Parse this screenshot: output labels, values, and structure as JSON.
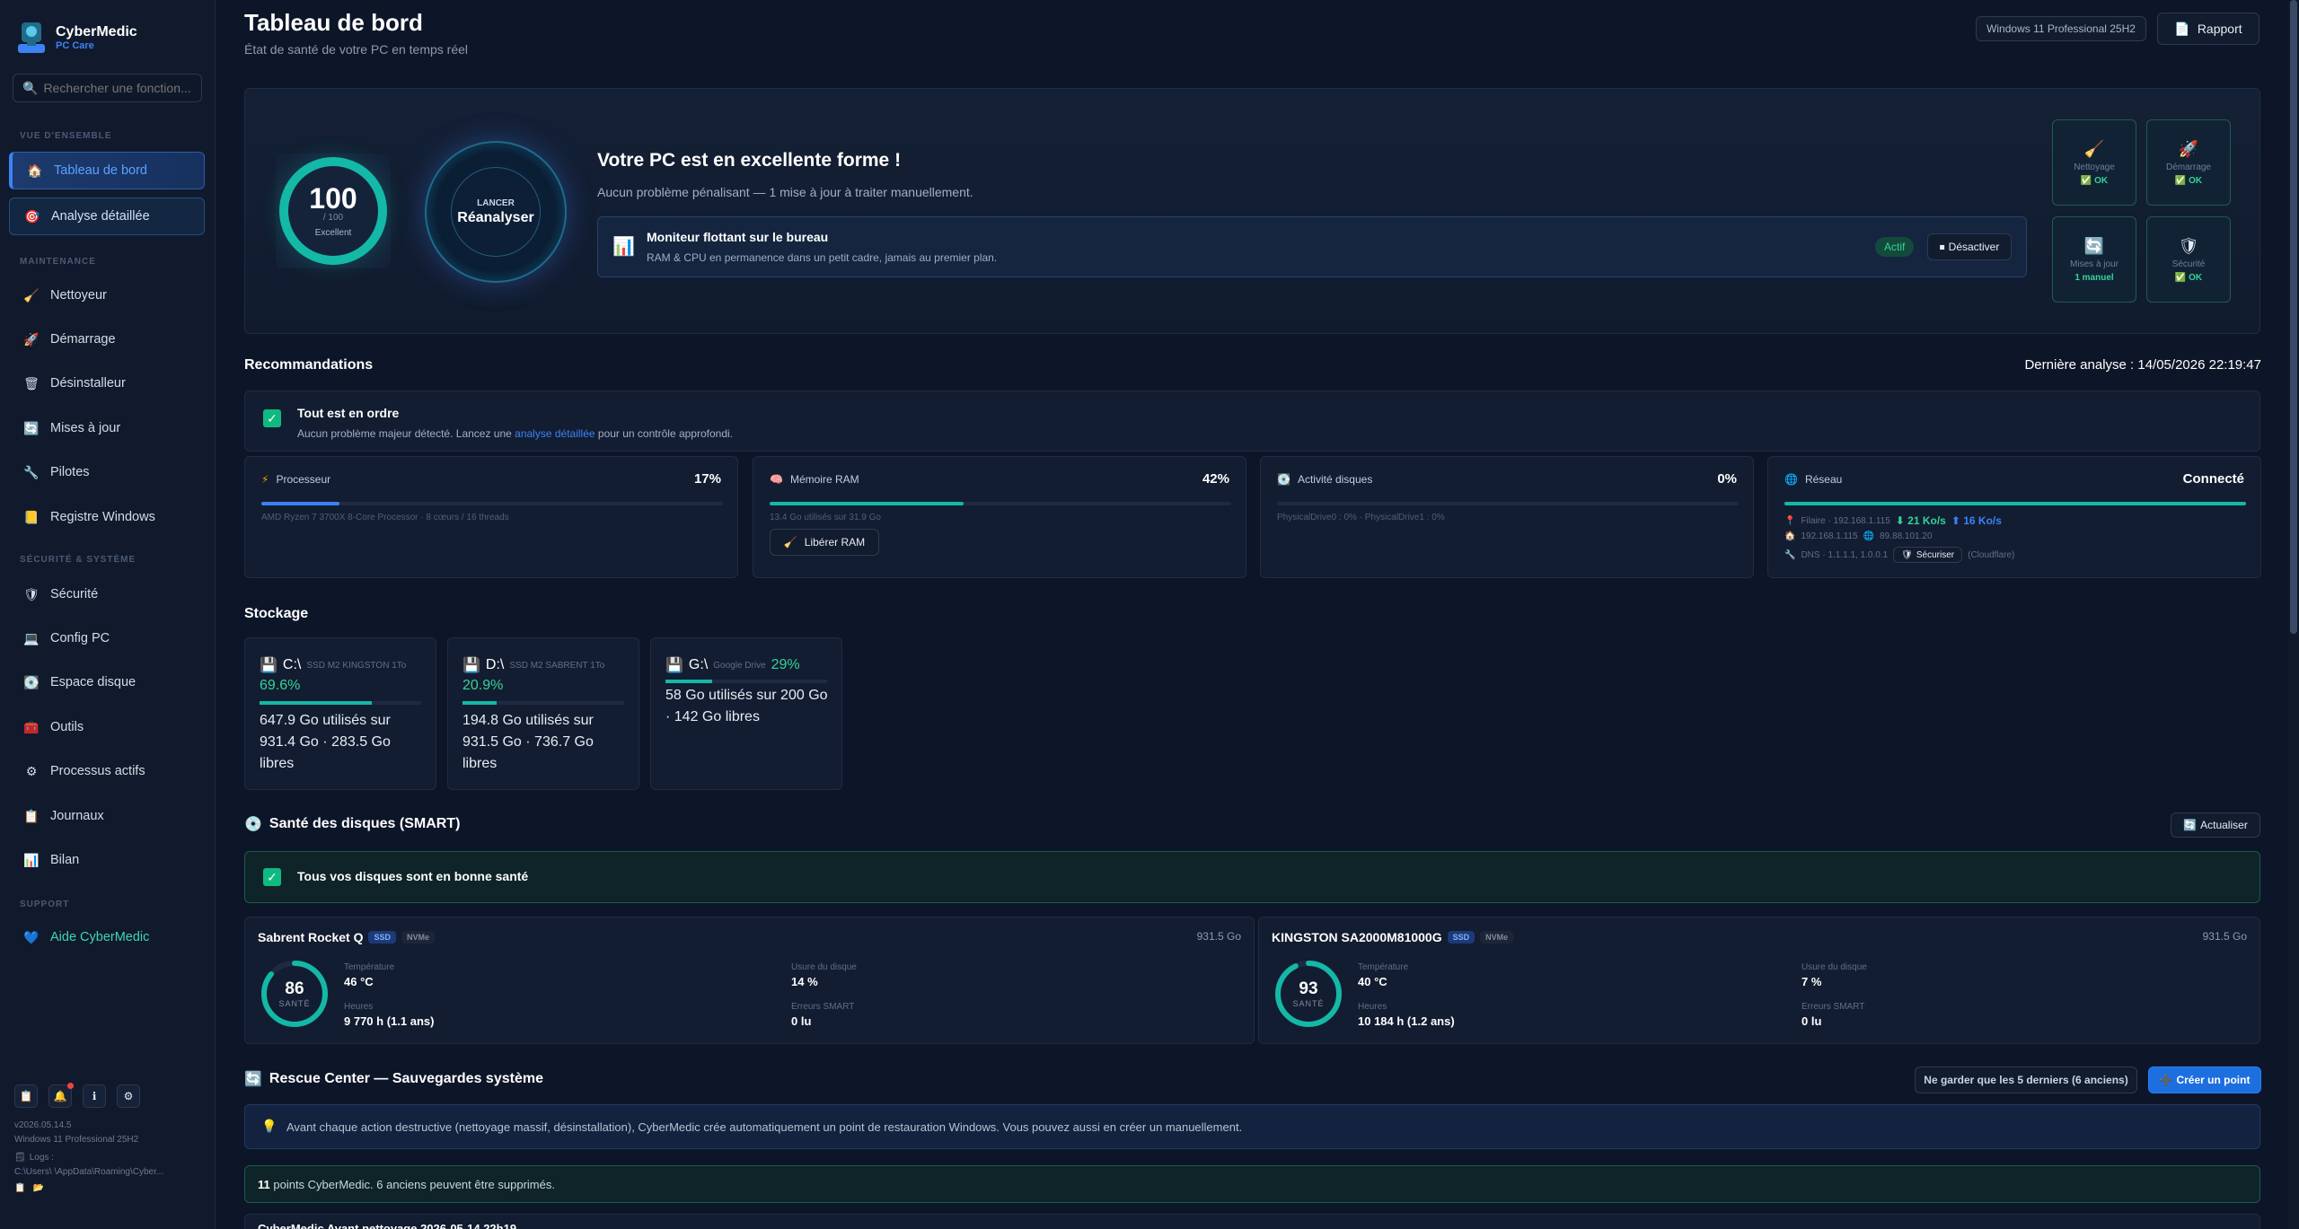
{
  "brand": {
    "name": "CyberMedic",
    "sub": "PC Care"
  },
  "search": {
    "placeholder": "Rechercher une fonction..."
  },
  "sidebar": {
    "sections": [
      "VUE D'ENSEMBLE",
      "MAINTENANCE",
      "SÉCURITÉ & SYSTÈME",
      "SUPPORT"
    ],
    "items": [
      {
        "label": "Tableau de bord",
        "icon": "🏠"
      },
      {
        "label": "Analyse détaillée",
        "icon": "🎯"
      },
      {
        "label": "Nettoyeur",
        "icon": "🧹"
      },
      {
        "label": "Démarrage",
        "icon": "🚀"
      },
      {
        "label": "Désinstalleur",
        "icon": "🗑"
      },
      {
        "label": "Mises à jour",
        "icon": "🔄"
      },
      {
        "label": "Pilotes",
        "icon": "🔧"
      },
      {
        "label": "Registre Windows",
        "icon": "📒"
      },
      {
        "label": "Sécurité",
        "icon": "🛡"
      },
      {
        "label": "Config PC",
        "icon": "💻"
      },
      {
        "label": "Espace disque",
        "icon": "💽"
      },
      {
        "label": "Outils",
        "icon": "🧰"
      },
      {
        "label": "Processus actifs",
        "icon": "⚙"
      },
      {
        "label": "Journaux",
        "icon": "📋"
      },
      {
        "label": "Bilan",
        "icon": "📊"
      },
      {
        "label": "Aide CyberMedic",
        "icon": "💙"
      }
    ],
    "version": "v2026.05.14.5",
    "os": "Windows 11 Professional 25H2",
    "logs_label": "Logs :",
    "logs_path": "C:\\Users\\     \\AppData\\Roaming\\Cyber..."
  },
  "header": {
    "title": "Tableau de bord",
    "subtitle": "État de santé de votre PC en temps réel",
    "os_badge": "Windows 11 Professional 25H2",
    "report_btn": "Rapport"
  },
  "hero": {
    "score": "100",
    "score_max": "/ 100",
    "score_label": "Excellent",
    "scan_l1": "LANCER",
    "scan_l2": "Réanalyser",
    "title": "Votre PC est en excellente forme !",
    "subtitle": "Aucun problème pénalisant — 1 mise à jour à traiter manuellement.",
    "monitor_title": "Moniteur flottant sur le bureau",
    "monitor_sub": "RAM & CPU en permanence dans un petit cadre, jamais au premier plan.",
    "monitor_status": "Actif",
    "monitor_btn": "Désactiver",
    "tiles": [
      {
        "name": "Nettoyage",
        "status": "✅ OK",
        "icon": "🧹"
      },
      {
        "name": "Démarrage",
        "status": "✅ OK",
        "icon": "🚀"
      },
      {
        "name": "Mises à jour",
        "status": "1 manuel",
        "icon": "🔄"
      },
      {
        "name": "Sécurité",
        "status": "✅ OK",
        "icon": "🛡"
      }
    ]
  },
  "reco": {
    "title": "Recommandations",
    "last_scan": "Dernière analyse : 14/05/2026 22:19:47",
    "ok_title": "Tout est en ordre",
    "ok_text_1": "Aucun problème majeur détecté. Lancez une ",
    "ok_link": "analyse détaillée",
    "ok_text_2": " pour un contrôle approfondi."
  },
  "metrics": {
    "cpu": {
      "label": "Processeur",
      "value": "17%",
      "pct": 17,
      "detail": "AMD Ryzen 7 3700X 8-Core Processor · 8 cœurs / 16 threads"
    },
    "ram": {
      "label": "Mémoire RAM",
      "value": "42%",
      "pct": 42,
      "detail": "13.4 Go utilisés sur 31.9 Go",
      "btn": "Libérer RAM"
    },
    "disk": {
      "label": "Activité disques",
      "value": "0%",
      "pct": 0,
      "detail": "PhysicalDrive0 : 0% · PhysicalDrive1 : 0%"
    },
    "net": {
      "label": "Réseau",
      "value": "Connecté",
      "pct": 100,
      "wired": "Filaire · 192.168.1.115",
      "down": "⬇ 21 Ko/s",
      "up": "⬆ 16 Ko/s",
      "lan": "192.168.1.115",
      "wan": "89.88.101.20",
      "dns": "DNS · 1.1.1.1, 1.0.0.1",
      "secure_btn": "Sécuriser",
      "provider": "(Cloudflare)"
    }
  },
  "storage": {
    "title": "Stockage",
    "drives": [
      {
        "letter": "C:\\",
        "model": "SSD M2 KINGSTON 1To",
        "pct_label": "69.6%",
        "pct": 69.6,
        "text": "647.9 Go utilisés sur 931.4 Go · 283.5 Go libres"
      },
      {
        "letter": "D:\\",
        "model": "SSD M2 SABRENT 1To",
        "pct_label": "20.9%",
        "pct": 20.9,
        "text": "194.8 Go utilisés sur 931.5 Go · 736.7 Go libres"
      },
      {
        "letter": "G:\\",
        "model": "Google Drive",
        "pct_label": "29%",
        "pct": 29,
        "text": "58 Go utilisés sur 200 Go · 142 Go libres"
      }
    ]
  },
  "smart": {
    "title": "Santé des disques (SMART)",
    "refresh_btn": "Actualiser",
    "ok_banner": "Tous vos disques sont en bonne santé",
    "disks": [
      {
        "name": "Sabrent Rocket Q",
        "type": "SSD",
        "bus": "NVMe",
        "size": "931.5 Go",
        "health": "86",
        "health_pct": 86,
        "health_label": "SANTÉ",
        "temp_label": "Température",
        "temp": "46 °C",
        "hours_label": "Heures",
        "hours": "9 770 h (1.1 ans)",
        "wear_label": "Usure du disque",
        "wear": "14 %",
        "err_label": "Erreurs SMART",
        "err": "0 lu"
      },
      {
        "name": "KINGSTON SA2000M81000G",
        "type": "SSD",
        "bus": "NVMe",
        "size": "931.5 Go",
        "health": "93",
        "health_pct": 93,
        "health_label": "SANTÉ",
        "temp_label": "Température",
        "temp": "40 °C",
        "hours_label": "Heures",
        "hours": "10 184 h (1.2 ans)",
        "wear_label": "Usure du disque",
        "wear": "7 %",
        "err_label": "Erreurs SMART",
        "err": "0 lu"
      }
    ]
  },
  "rescue": {
    "title": "Rescue Center — Sauvegardes système",
    "keep_btn": "Ne garder que les 5 derniers (6 anciens)",
    "create_btn": "Créer un point",
    "info": "Avant chaque action destructive (nettoyage massif, désinstallation), CyberMedic crée automatiquement un point de restauration Windows. Vous pouvez aussi en créer un manuellement.",
    "count": "11",
    "count_text": " points CyberMedic. 6 anciens peuvent être supprimés.",
    "first_item": "CyberMedic Avant nettoyage 2026-05-14 22h19"
  },
  "colors": {
    "accent": "#3b82f6",
    "ok": "#14b8a6",
    "good": "#34d399",
    "bg": "#0d1628"
  }
}
